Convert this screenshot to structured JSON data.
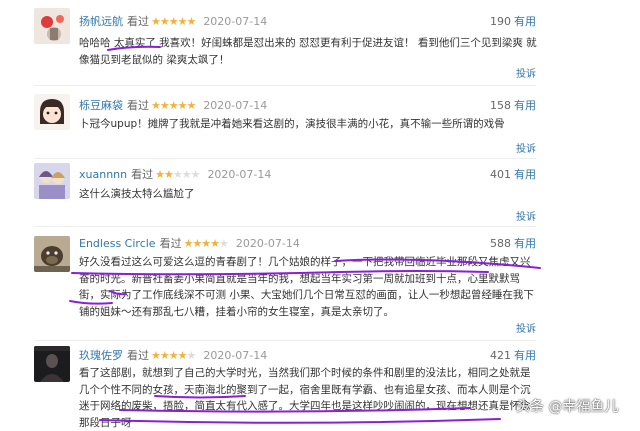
{
  "reviews": [
    {
      "user": "扬帆远航",
      "watched": "看过",
      "stars": "★★★★★",
      "stars_off": "",
      "date": "2020-07-14",
      "votes": "190",
      "useful": "有用",
      "text": "哈哈哈 太真实了 我喜欢！好闺蛛都是怼出来的 怼怼更有利于促进友谊！ 看到他们三个见到梁爽 就像猫见到老鼠似的 梁爽太飒了！",
      "report": "投诉"
    },
    {
      "user": "栎豆麻袋",
      "watched": "看过",
      "stars": "★★★★★",
      "stars_off": "",
      "date": "2020-07-14",
      "votes": "158",
      "useful": "有用",
      "text": "卜冠今upup！摊牌了我就是冲着她来看这剧的，演技很丰满的小花，真不输一些所谓的戏骨",
      "report": "投诉"
    },
    {
      "user": "xuannnn",
      "watched": "看过",
      "stars": "★★",
      "stars_off": "★★★",
      "date": "2020-07-14",
      "votes": "401",
      "useful": "有用",
      "text": "这什么演技太特么尴尬了",
      "report": "投诉"
    },
    {
      "user": "Endless Circle",
      "watched": "看过",
      "stars": "★★★★",
      "stars_off": "★",
      "date": "2020-07-14",
      "votes": "588",
      "useful": "有用",
      "text": "好久没看过这么可爱这么逗的青春剧了！几个姑娘的样子，一下把我带回临近毕业那段又焦虑又兴奋的时光。新晋社畜姜小果简直就是当年的我，想起当年实习第一周就加班到十点，心里默默骂街，实际为了工作底线深不可测 小果、大宝她们几个日常互怼的画面，让人一秒想起曾经睡在我下铺的姐妹～还有那乱七八糟，挂着小帘的女生寝室，真是太亲切了。",
      "report": "投诉"
    },
    {
      "user": "玖瑰佐罗",
      "watched": "看过",
      "stars": "★★★★",
      "stars_off": "★",
      "date": "2020-07-14",
      "votes": "421",
      "useful": "有用",
      "text": "看了这部剧，就想到了自己的大学时光，当然我们那个时候的条件和剧里的没法比，相同之处就是几个个性不同的女孩，天南海北的聚到了一起，宿舍里既有学霸、也有追星女孩、而本人则是个沉迷于网络的废柴，捂脸，简直太有代入感了。大学四年也是这样吵吵闹闹的，现在想想还真是怀念那段日子呀",
      "report": ""
    }
  ],
  "watermark": "头条 @幸福鱼儿",
  "colors": {
    "link": "#3377aa",
    "star": "#f4b13a",
    "ink": "#8a1fd6"
  },
  "avatars": [
    "lantern-girl-avatar",
    "cartoon-girl-avatar",
    "anime-couple-avatar",
    "dog-avatar",
    "dark-figure-avatar"
  ]
}
